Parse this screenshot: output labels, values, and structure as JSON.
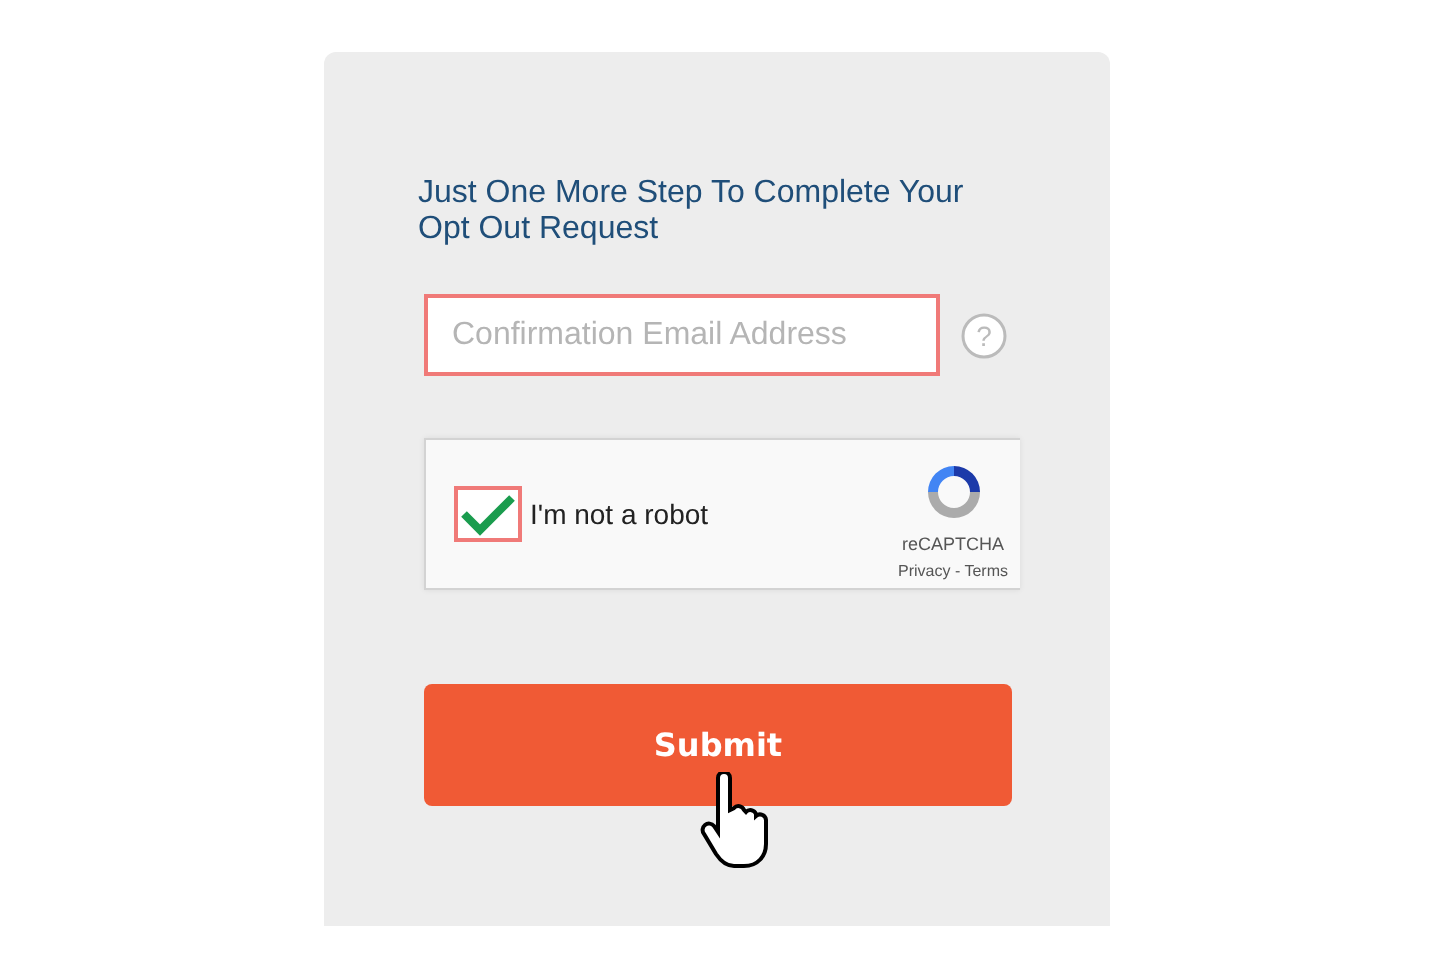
{
  "heading": "Just One More Step To Complete Your Opt Out Request",
  "email_field": {
    "placeholder": "Confirmation Email Address",
    "highlighted": true,
    "help_mark": "?"
  },
  "captcha": {
    "label": "I'm not a robot",
    "checked": true,
    "highlighted": true,
    "brand": "reCAPTCHA",
    "links": "Privacy - Terms"
  },
  "submit_button": {
    "label": "Submit"
  }
}
